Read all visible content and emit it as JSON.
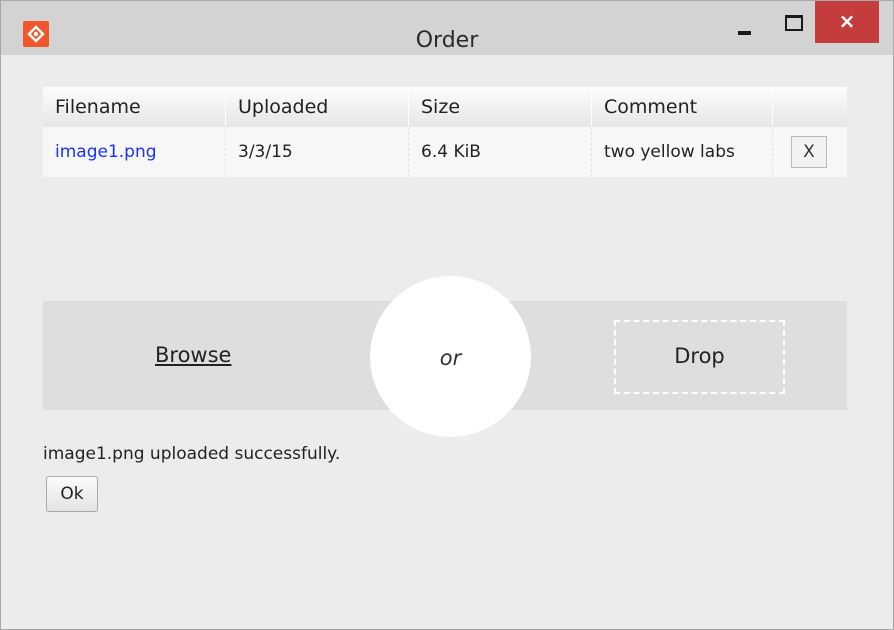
{
  "window": {
    "title": "Order",
    "minimize_icon": "minimize-icon",
    "maximize_icon": "maximize-icon",
    "close_label": "×",
    "app_icon": "app-logo-icon",
    "app_icon_color": "#f0572a",
    "close_color": "#c43c3c"
  },
  "table": {
    "columns": [
      "Filename",
      "Uploaded",
      "Size",
      "Comment",
      ""
    ],
    "rows": [
      {
        "filename": "image1.png",
        "uploaded": "3/3/15",
        "size": "6.4 KiB",
        "comment": "two yellow labs",
        "remove_label": "X"
      }
    ]
  },
  "upload": {
    "browse_label": "Browse",
    "or_label": "or",
    "drop_label": "Drop"
  },
  "status": {
    "message": "image1.png uploaded successfully.",
    "ok_label": "Ok"
  },
  "colors": {
    "link": "#1a32ff",
    "background": "#ececec",
    "titlebar": "#d3d3d3"
  }
}
